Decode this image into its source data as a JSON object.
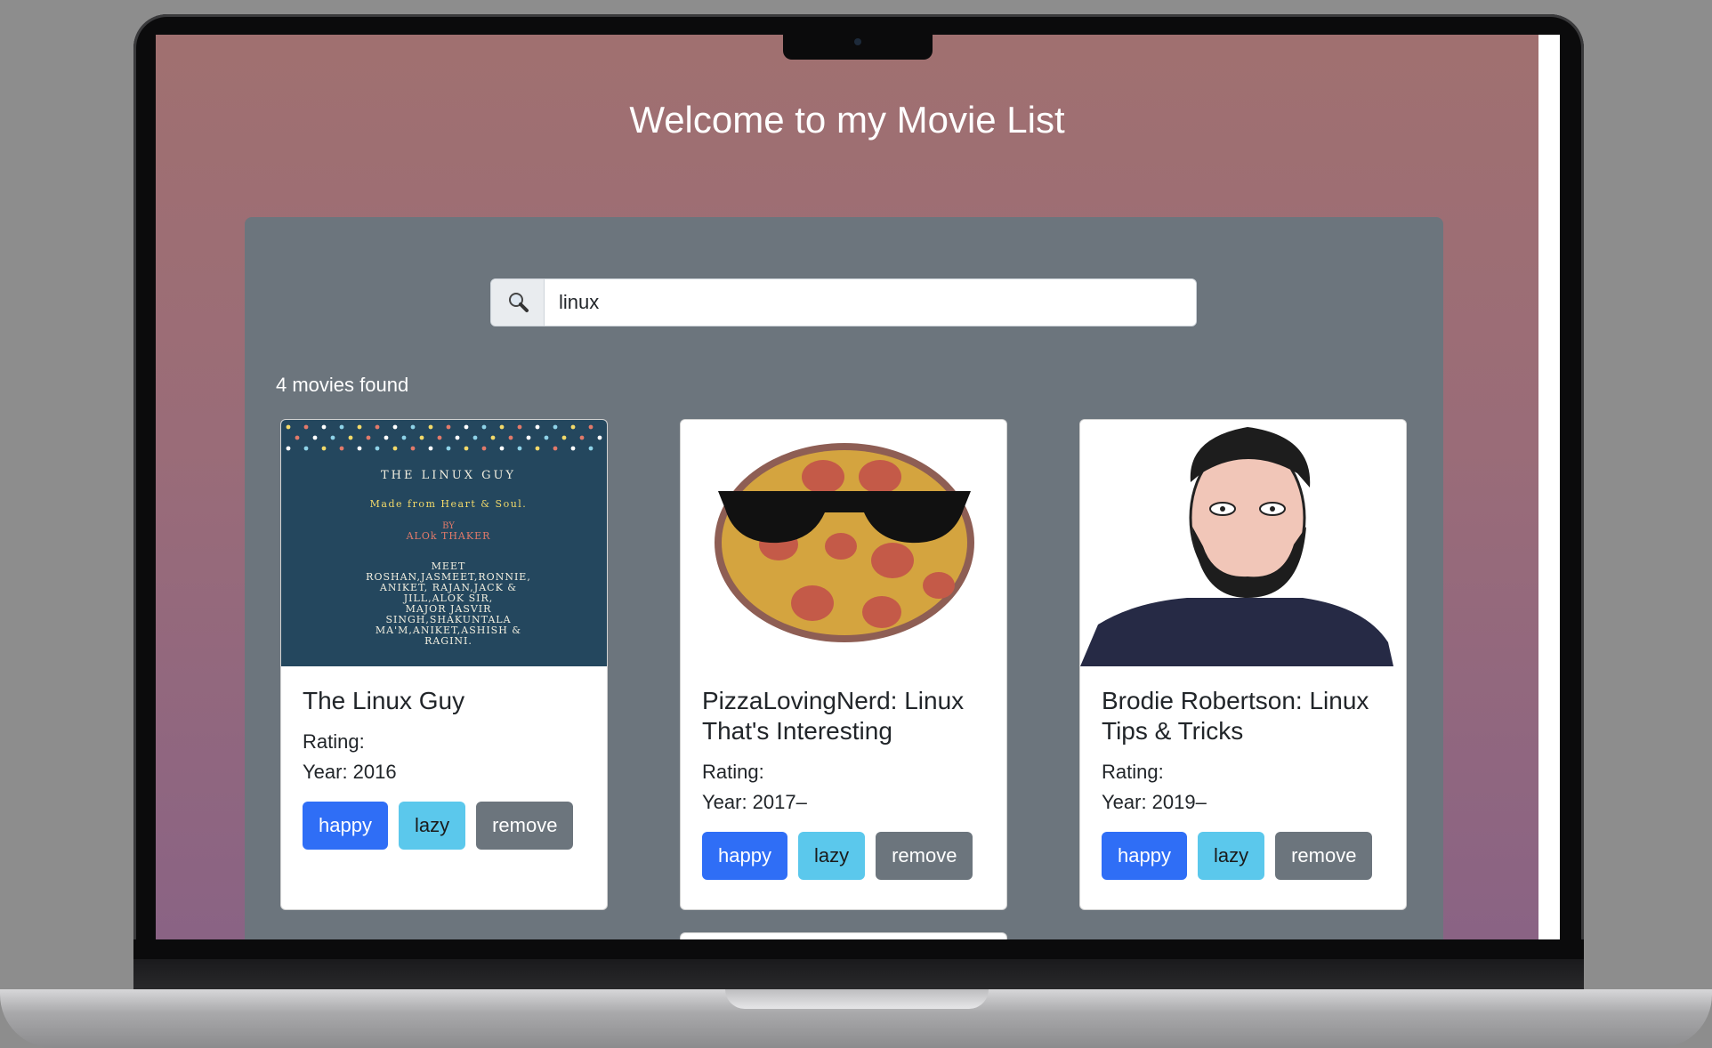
{
  "app": {
    "title": "Welcome to my Movie List"
  },
  "search": {
    "icon": "magnifying-glass-icon",
    "value": "linux",
    "placeholder": ""
  },
  "results": {
    "count_text": "4 movies found"
  },
  "poster_text": {
    "line1": "THE LINUX GUY",
    "line2": "Made from Heart & Soul.",
    "line3": "BY",
    "line4": "ALOk THAKER",
    "line5": "MEET",
    "line6": "ROSHAN,JASMEET,RONNIE,",
    "line7": "ANIKET, RAJAN,JACK &",
    "line8": "JILL,ALOK SIR,",
    "line9": "MAJOR JASVIR",
    "line10": "SINGH,SHAKUNTALA",
    "line11": "MA'M,ANIKET,ASHISH &",
    "line12": "RAGINI."
  },
  "movies": [
    {
      "title": "The Linux Guy",
      "rating_label": "Rating:",
      "year_label": "Year: 2016",
      "poster": "text-poster"
    },
    {
      "title": "PizzaLovingNerd: Linux That's Interesting",
      "rating_label": "Rating:",
      "year_label": "Year: 2017–",
      "poster": "pizza-with-sunglasses"
    },
    {
      "title": "Brodie Robertson: Linux Tips & Tricks",
      "rating_label": "Rating:",
      "year_label": "Year: 2019–",
      "poster": "bearded-man-illustration"
    }
  ],
  "buttons": {
    "happy": "happy",
    "lazy": "lazy",
    "remove": "remove"
  },
  "colors": {
    "happy": "#2f6ef6",
    "lazy": "#5bc8ec",
    "remove": "#6c757d",
    "panel": "#6c757d"
  }
}
